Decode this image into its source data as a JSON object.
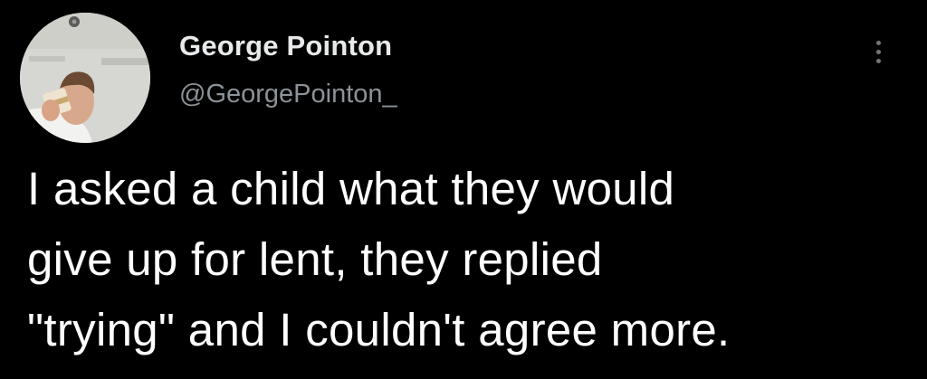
{
  "tweet": {
    "author": {
      "display_name": "George Pointon",
      "handle": "@GeorgePointon_",
      "avatar_icon": "profile-photo-icon"
    },
    "more_icon": "more-vertical-icon",
    "text_lines": [
      "I asked a child what they would",
      "give up for lent, they replied",
      "\"trying\" and I couldn't agree more."
    ]
  },
  "colors": {
    "background": "#000000",
    "name": "#e7e9ea",
    "handle": "#8b9298",
    "body": "#ffffff"
  }
}
